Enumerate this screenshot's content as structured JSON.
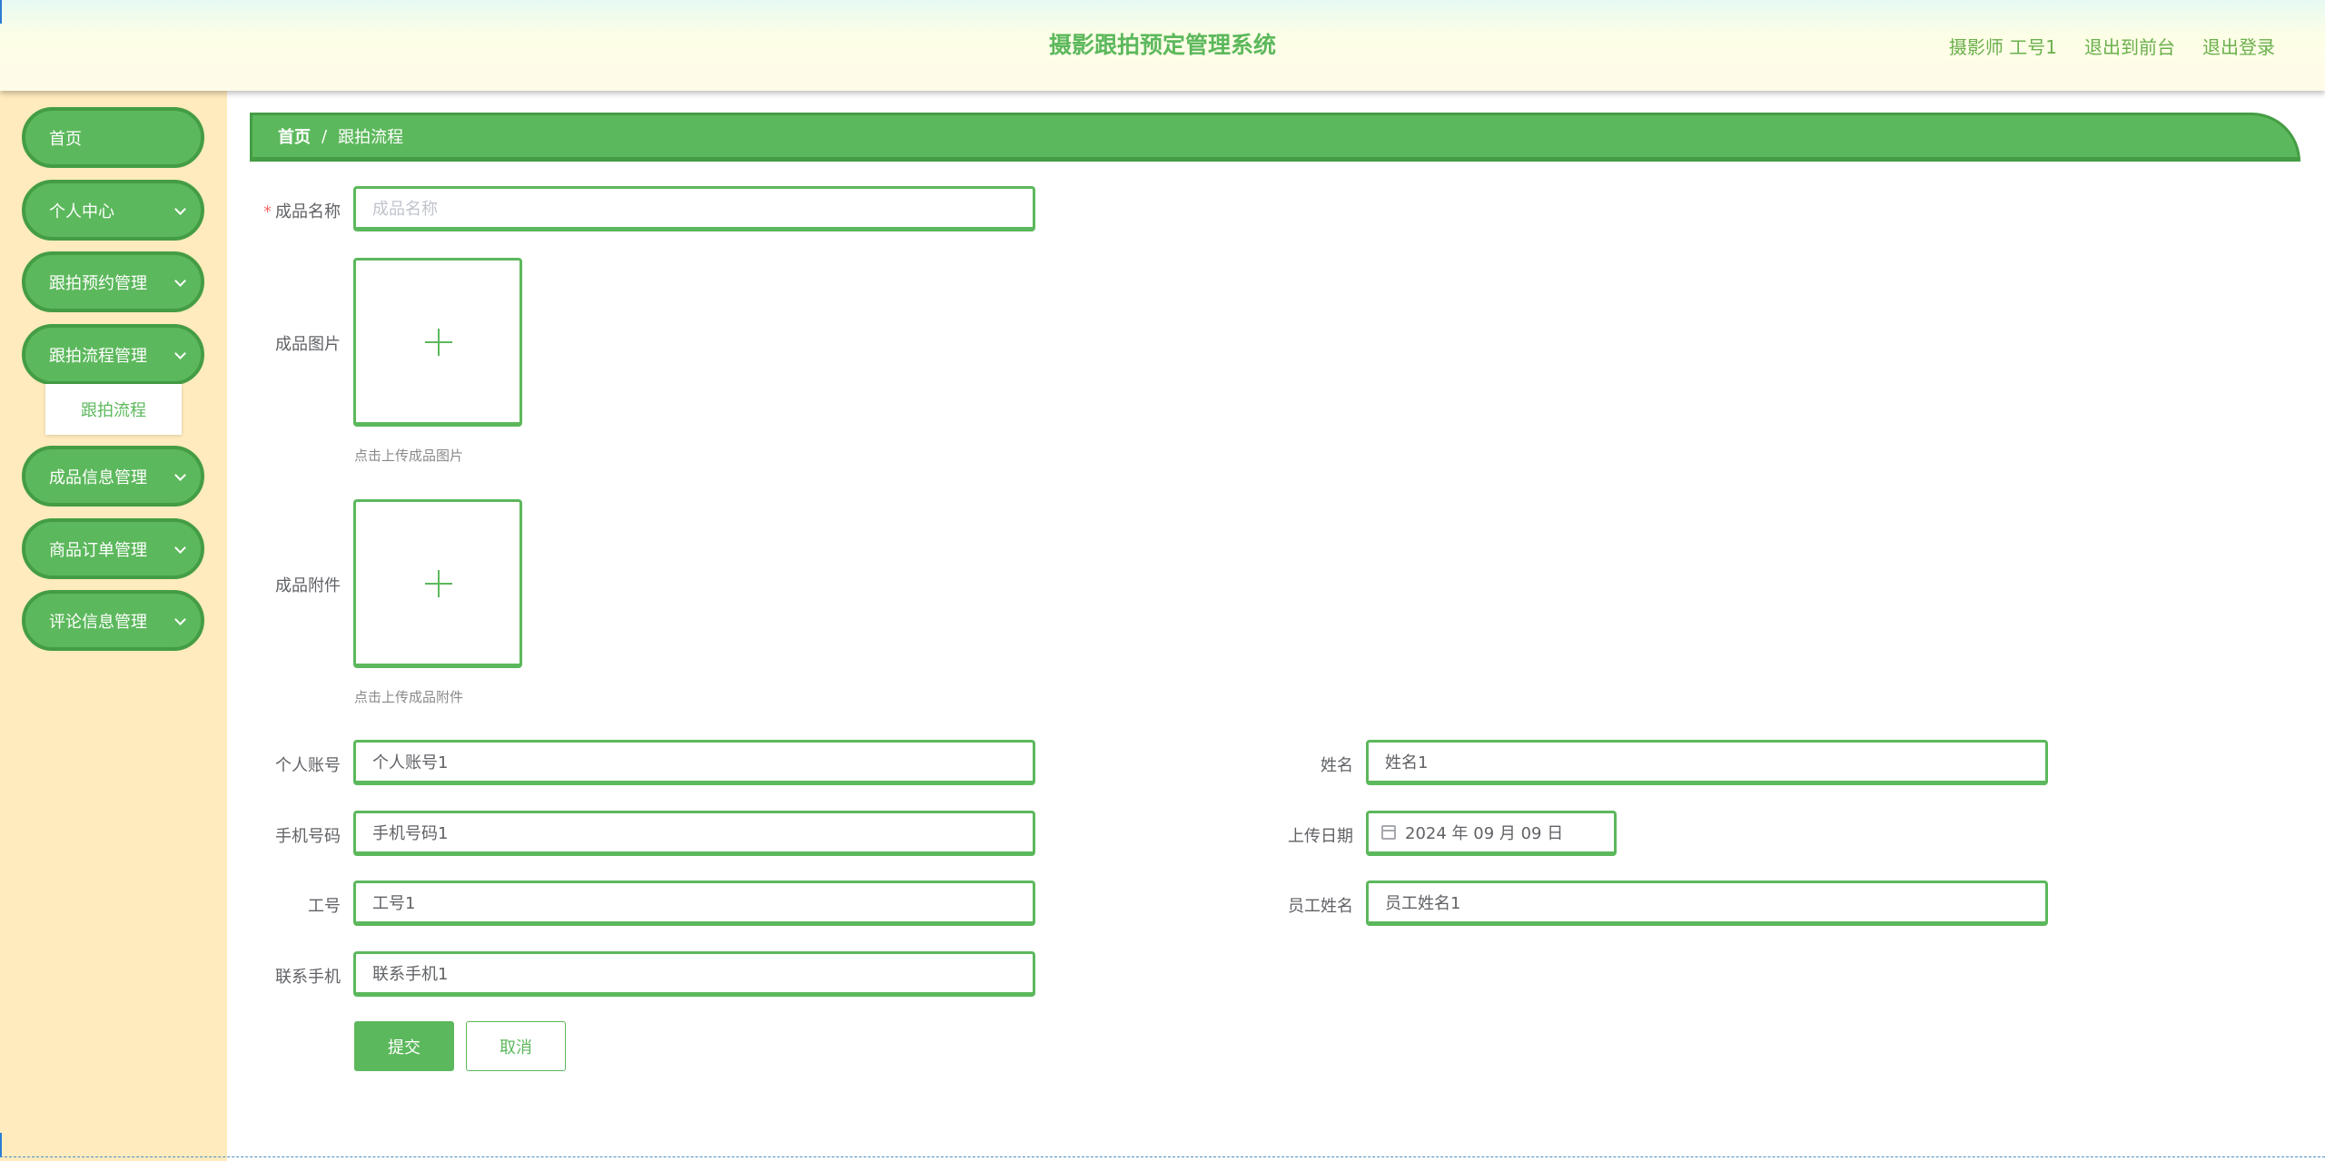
{
  "header": {
    "title": "摄影跟拍预定管理系统",
    "user": "摄影师 工号1",
    "back_to_front": "退出到前台",
    "logout": "退出登录"
  },
  "sidebar": {
    "items": [
      {
        "label": "首页",
        "has_children": false
      },
      {
        "label": "个人中心",
        "has_children": true
      },
      {
        "label": "跟拍预约管理",
        "has_children": true
      },
      {
        "label": "跟拍流程管理",
        "has_children": true,
        "expanded": true
      },
      {
        "label": "成品信息管理",
        "has_children": true
      },
      {
        "label": "商品订单管理",
        "has_children": true
      },
      {
        "label": "评论信息管理",
        "has_children": true
      }
    ],
    "submenu": {
      "label": "跟拍流程"
    }
  },
  "breadcrumb": {
    "home": "首页",
    "separator": "/",
    "current": "跟拍流程"
  },
  "form": {
    "product_name": {
      "label": "成品名称",
      "required_mark": "*",
      "placeholder": "成品名称",
      "value": ""
    },
    "product_image": {
      "label": "成品图片",
      "tip": "点击上传成品图片"
    },
    "product_attachment": {
      "label": "成品附件",
      "tip": "点击上传成品附件"
    },
    "account": {
      "label": "个人账号",
      "value": "个人账号1"
    },
    "name": {
      "label": "姓名",
      "value": "姓名1"
    },
    "phone": {
      "label": "手机号码",
      "value": "手机号码1"
    },
    "upload_date": {
      "label": "上传日期",
      "value": "2024 年 09 月 09 日"
    },
    "job_no": {
      "label": "工号",
      "value": "工号1"
    },
    "staff_name": {
      "label": "员工姓名",
      "value": "员工姓名1"
    },
    "contact_phone": {
      "label": "联系手机",
      "value": "联系手机1"
    },
    "submit_label": "提交",
    "cancel_label": "取消"
  },
  "colors": {
    "primary": "#5cb85c",
    "primary_dark": "#449d44",
    "sidebar_bg": "#ffebbd",
    "required": "#f56c6c"
  }
}
